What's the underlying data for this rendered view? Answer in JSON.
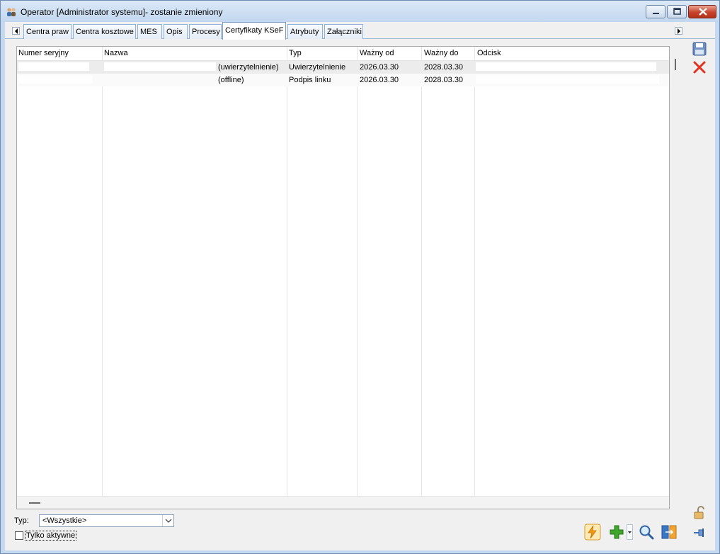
{
  "window": {
    "title": "Operator [Administrator systemu]- zostanie zmieniony"
  },
  "tabs": [
    {
      "label": "Centra praw",
      "active": false
    },
    {
      "label": "Centra kosztowe",
      "active": false
    },
    {
      "label": "MES",
      "active": false
    },
    {
      "label": "Opis",
      "active": false
    },
    {
      "label": "Procesy",
      "active": false
    },
    {
      "label": "Certyfikaty KSeF",
      "active": true
    },
    {
      "label": "Atrybuty",
      "active": false
    },
    {
      "label": "Załączniki",
      "active": false
    }
  ],
  "grid": {
    "columns": [
      "Numer seryjny",
      "Nazwa",
      "Typ",
      "Ważny od",
      "Ważny do",
      "Odcisk"
    ],
    "rows": [
      {
        "serial": "",
        "name": "(uwierzytelnienie)",
        "type": "Uwierzytelnienie",
        "valid_from": "2026.03.30",
        "valid_to": "2028.03.30",
        "fingerprint": ""
      },
      {
        "serial": "",
        "name": "(offline)",
        "type": "Podpis linku",
        "valid_from": "2026.03.30",
        "valid_to": "2028.03.30",
        "fingerprint": ""
      }
    ]
  },
  "filters": {
    "type_label": "Typ:",
    "type_value": "<Wszystkie>",
    "only_active_label": "Tylko aktywne",
    "only_active_checked": false
  },
  "icons": {
    "save": "save-icon",
    "delete": "delete-icon",
    "lock": "lock-icon",
    "pin": "pin-icon",
    "lightning": "lightning-icon",
    "add": "add-icon",
    "search": "search-icon",
    "swap": "swap-icon"
  },
  "colors": {
    "accent": "#7c9cc4",
    "close_red": "#c8432c",
    "add_green": "#3fa82c",
    "lightning_orange": "#f29a12"
  }
}
